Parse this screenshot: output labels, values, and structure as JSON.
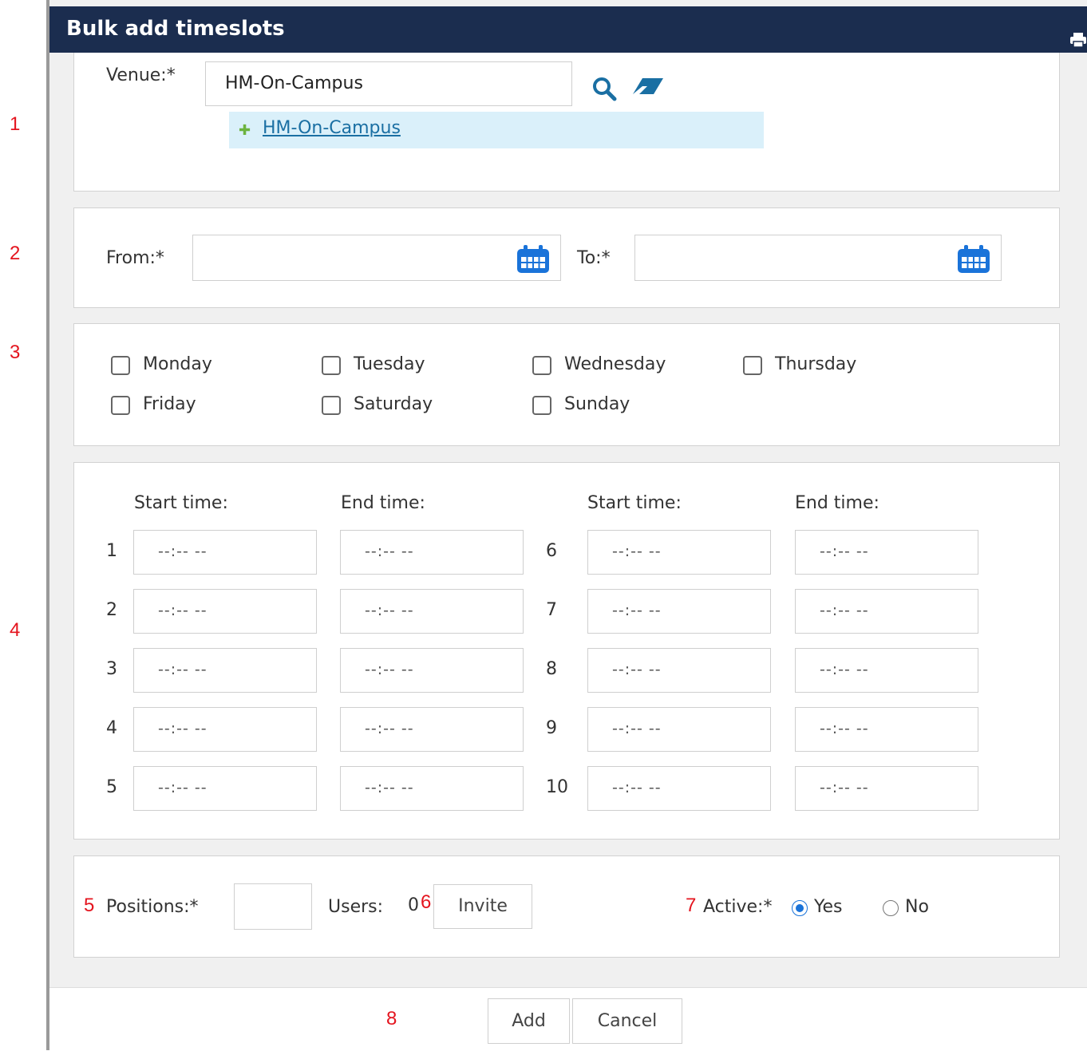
{
  "dialog": {
    "title": "Bulk add timeslots"
  },
  "annotations": [
    "1",
    "2",
    "3",
    "4",
    "5",
    "6",
    "7",
    "8"
  ],
  "venue": {
    "label": "Venue:*",
    "value": "HM-On-Campus",
    "suggestion": "HM-On-Campus"
  },
  "dates": {
    "from_label": "From:*",
    "to_label": "To:*",
    "from_value": "",
    "to_value": ""
  },
  "days": [
    "Monday",
    "Tuesday",
    "Wednesday",
    "Thursday",
    "Friday",
    "Saturday",
    "Sunday"
  ],
  "times": {
    "start_label": "Start time:",
    "end_label": "End time:",
    "placeholder": "--:-- --",
    "rows_left": [
      "1",
      "2",
      "3",
      "4",
      "5"
    ],
    "rows_right": [
      "6",
      "7",
      "8",
      "9",
      "10"
    ]
  },
  "positions": {
    "label": "Positions:*",
    "value": ""
  },
  "users": {
    "label": "Users:",
    "count": "0",
    "invite_label": "Invite"
  },
  "active": {
    "label": "Active:*",
    "yes": "Yes",
    "no": "No",
    "selected": "Yes"
  },
  "buttons": {
    "add": "Add",
    "cancel": "Cancel"
  },
  "colors": {
    "header": "#1b2d4f",
    "link": "#1a6fa3",
    "annotation": "#e4141e",
    "calendar": "#1a73d9"
  }
}
